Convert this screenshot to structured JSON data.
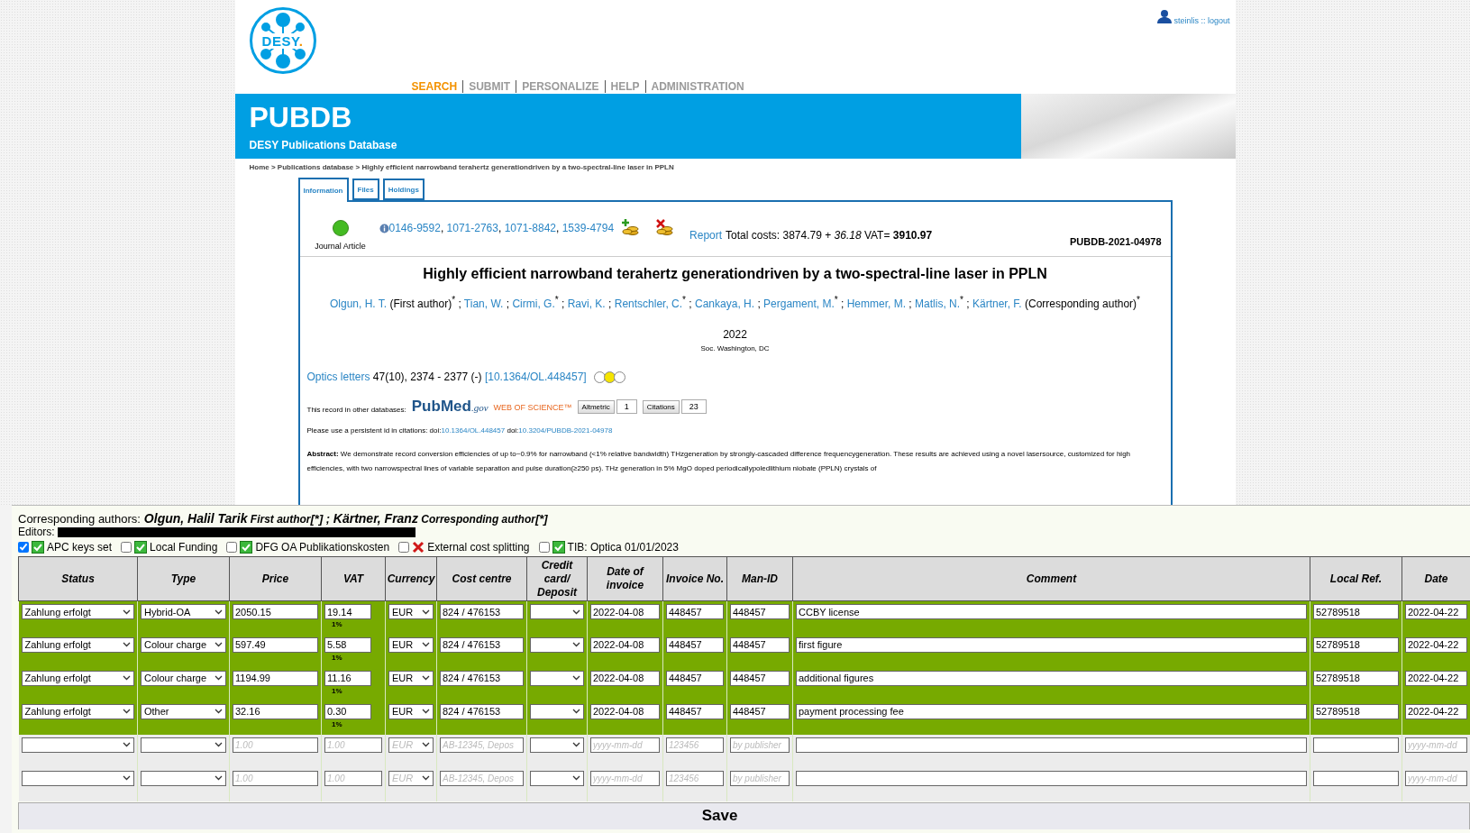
{
  "user": {
    "link": "steinlis :: logout"
  },
  "logo": {
    "text": "DESY",
    "dot": "."
  },
  "nav": [
    {
      "label": "SEARCH",
      "selected": true
    },
    {
      "label": "SUBMIT",
      "selected": false
    },
    {
      "label": "PERSONALIZE",
      "selected": false
    },
    {
      "label": "HELP",
      "selected": false
    },
    {
      "label": "ADMINISTRATION",
      "selected": false
    }
  ],
  "banner": {
    "title": "PUBDB",
    "subtitle": "DESY Publications Database"
  },
  "breadcrumb": "Home > Publications database > Highly efficient narrowband terahertz generationdriven by a two-spectral-line laser in PPLN",
  "tabs": [
    {
      "label": "Information",
      "selected": true
    },
    {
      "label": "Files",
      "selected": false
    },
    {
      "label": "Holdings",
      "selected": false
    }
  ],
  "record": {
    "approved": true,
    "issns": [
      "0146-9592",
      "1071-2763",
      "1071-8842",
      "1539-4794"
    ],
    "issn_separator": ", ",
    "report_link": "Report",
    "costs": "Total costs: 3874.79 + *36.18* VAT= **3910.97**",
    "type": "Journal Article",
    "id": "PUBDB-2021-04978",
    "title": "Highly efficient narrowband terahertz generationdriven by a two-spectral-line laser in PPLN",
    "author_separator": " ; ",
    "authors": [
      {
        "name": "Olgun, H. T.",
        "note": " (First author)$^{*}$"
      },
      {
        "name": "Tian, W."
      },
      {
        "name": "Cirmi, G.",
        "note": "$^{*}$"
      },
      {
        "name": "Ravi, K."
      },
      {
        "name": "Rentschler, C.",
        "note": "$^{*}$"
      },
      {
        "name": "Cankaya, H."
      },
      {
        "name": "Pergament, M.",
        "note": "$^{*}$"
      },
      {
        "name": "Hemmer, M."
      },
      {
        "name": "Matlis, N.",
        "note": "$^{*}$"
      },
      {
        "name": "Kärtner, F.",
        "note": " (Corresponding author)$^{*}$"
      }
    ],
    "year": "2022",
    "publisher": "Soc. Washington, DC",
    "journal": "Optics letters",
    "pages": " 47(10), 2374 - 2377 (-) ",
    "doi_link": "[10.1364/OL.448457]",
    "oa_lights": [
      {
        "selected": false
      },
      {
        "selected": true
      },
      {
        "selected": false
      }
    ],
    "other_db_label": "This record in other databases:",
    "pubmed": "PubMed",
    "pubmed_suffix": ".gov",
    "wos": "WEB OF SCIENCE™",
    "altmetric": "Altmetric",
    "altmetric_count": "1",
    "citations": "Citations",
    "citations_count": "23",
    "persistent_label": "Please use a persistent id in citations: doi:",
    "persistent_doi": "10.1364/OL.448457",
    "persistent_label2": " doi:",
    "persistent_doi2": "10.3204/PUBDB-2021-04978",
    "abstract": "**Abstract:** We demonstrate record conversion efficiencies of up to~0.9% for narrowband (<1% relative bandwidth) THzgeneration by strongly-cascaded difference frequencygeneration. These results are achieved using a novel lasersource, customized for high efficiencies, with two narrowspectral lines of variable separation and pulse duration(≥250 ps). THz generation in 5% MgO doped periodicallypoledlithium niobate (PPLN) crystals of"
  },
  "panel": {
    "corresponding_label": "Corresponding authors:",
    "corresponding_separator": " ; ",
    "corresponding": [
      {
        "name": "Olgun, Halil Tarik",
        "role": "First author",
        "mark": "[*]"
      },
      {
        "name": "Kärtner, Franz",
        "role": "Corresponding author",
        "mark": "[*]"
      }
    ],
    "editors_label": "Editors:",
    "flags": [
      {
        "label": "APC keys set",
        "checked": true,
        "kind": "ok"
      },
      {
        "label": "Local Funding",
        "checked": false,
        "kind": "ok"
      },
      {
        "label": "DFG OA Publikationskosten",
        "checked": false,
        "kind": "ok"
      },
      {
        "label": "External cost splitting",
        "checked": false,
        "kind": "error"
      },
      {
        "label": "TIB: Optica 01/01/2023",
        "checked": false,
        "kind": "ok"
      }
    ],
    "columns": [
      "Status",
      "Type",
      "Price",
      "VAT",
      "Currency",
      "Cost centre",
      "Credit card/ Deposit",
      "Date of invoice",
      "Invoice No.",
      "Man-ID",
      "Comment",
      "Local Ref.",
      "Date"
    ],
    "rows": [
      {
        "filled": true,
        "cells": [
          {
            "kind": "select",
            "value": "Zahlung erfolgt"
          },
          {
            "kind": "select",
            "value": "Hybrid-OA"
          },
          {
            "kind": "input",
            "value": "2050.15"
          },
          {
            "kind": "input",
            "value": "19.14",
            "note": "1%"
          },
          {
            "kind": "select",
            "value": "EUR"
          },
          {
            "kind": "input",
            "value": "824 / 476153"
          },
          {
            "kind": "select"
          },
          {
            "kind": "input",
            "value": "2022-04-08"
          },
          {
            "kind": "input",
            "value": "448457"
          },
          {
            "kind": "input",
            "value": "448457"
          },
          {
            "kind": "input",
            "value": "CCBY license"
          },
          {
            "kind": "input",
            "value": "52789518"
          },
          {
            "kind": "input",
            "value": "2022-04-22"
          }
        ]
      },
      {
        "filled": true,
        "cells": [
          {
            "kind": "select",
            "value": "Zahlung erfolgt"
          },
          {
            "kind": "select",
            "value": "Colour charge"
          },
          {
            "kind": "input",
            "value": "597.49"
          },
          {
            "kind": "input",
            "value": "5.58",
            "note": "1%"
          },
          {
            "kind": "select",
            "value": "EUR"
          },
          {
            "kind": "input",
            "value": "824 / 476153"
          },
          {
            "kind": "select"
          },
          {
            "kind": "input",
            "value": "2022-04-08"
          },
          {
            "kind": "input",
            "value": "448457"
          },
          {
            "kind": "input",
            "value": "448457"
          },
          {
            "kind": "input",
            "value": "first figure"
          },
          {
            "kind": "input",
            "value": "52789518"
          },
          {
            "kind": "input",
            "value": "2022-04-22"
          }
        ]
      },
      {
        "filled": true,
        "cells": [
          {
            "kind": "select",
            "value": "Zahlung erfolgt"
          },
          {
            "kind": "select",
            "value": "Colour charge"
          },
          {
            "kind": "input",
            "value": "1194.99"
          },
          {
            "kind": "input",
            "value": "11.16",
            "note": "1%"
          },
          {
            "kind": "select",
            "value": "EUR"
          },
          {
            "kind": "input",
            "value": "824 / 476153"
          },
          {
            "kind": "select"
          },
          {
            "kind": "input",
            "value": "2022-04-08"
          },
          {
            "kind": "input",
            "value": "448457"
          },
          {
            "kind": "input",
            "value": "448457"
          },
          {
            "kind": "input",
            "value": "additional figures"
          },
          {
            "kind": "input",
            "value": "52789518"
          },
          {
            "kind": "input",
            "value": "2022-04-22"
          }
        ]
      },
      {
        "filled": true,
        "cells": [
          {
            "kind": "select",
            "value": "Zahlung erfolgt"
          },
          {
            "kind": "select",
            "value": "Other"
          },
          {
            "kind": "input",
            "value": "32.16"
          },
          {
            "kind": "input",
            "value": "0.30",
            "note": "1%"
          },
          {
            "kind": "select",
            "value": "EUR"
          },
          {
            "kind": "input",
            "value": "824 / 476153"
          },
          {
            "kind": "select"
          },
          {
            "kind": "input",
            "value": "2022-04-08"
          },
          {
            "kind": "input",
            "value": "448457"
          },
          {
            "kind": "input",
            "value": "448457"
          },
          {
            "kind": "input",
            "value": "payment processing fee"
          },
          {
            "kind": "input",
            "value": "52789518"
          },
          {
            "kind": "input",
            "value": "2022-04-22"
          }
        ]
      },
      {
        "filled": false,
        "cells": [
          {
            "kind": "select"
          },
          {
            "kind": "select"
          },
          {
            "kind": "input",
            "placeholder": "1.00"
          },
          {
            "kind": "input",
            "placeholder": "1.00"
          },
          {
            "kind": "select",
            "placeholder": "EUR"
          },
          {
            "kind": "input",
            "placeholder": "AB-12345, Depos"
          },
          {
            "kind": "select"
          },
          {
            "kind": "input",
            "placeholder": "yyyy-mm-dd"
          },
          {
            "kind": "input",
            "placeholder": "123456"
          },
          {
            "kind": "input",
            "placeholder": "by publisher"
          },
          {
            "kind": "input"
          },
          {
            "kind": "input"
          },
          {
            "kind": "input",
            "placeholder": "yyyy-mm-dd"
          }
        ]
      },
      {
        "filled": false,
        "cells": [
          {
            "kind": "select"
          },
          {
            "kind": "select"
          },
          {
            "kind": "input",
            "placeholder": "1.00"
          },
          {
            "kind": "input",
            "placeholder": "1.00"
          },
          {
            "kind": "select",
            "placeholder": "EUR"
          },
          {
            "kind": "input",
            "placeholder": "AB-12345, Depos"
          },
          {
            "kind": "select"
          },
          {
            "kind": "input",
            "placeholder": "yyyy-mm-dd"
          },
          {
            "kind": "input",
            "placeholder": "123456"
          },
          {
            "kind": "input",
            "placeholder": "by publisher"
          },
          {
            "kind": "input"
          },
          {
            "kind": "input"
          },
          {
            "kind": "input",
            "placeholder": "yyyy-mm-dd"
          }
        ]
      }
    ],
    "save": "Save"
  }
}
